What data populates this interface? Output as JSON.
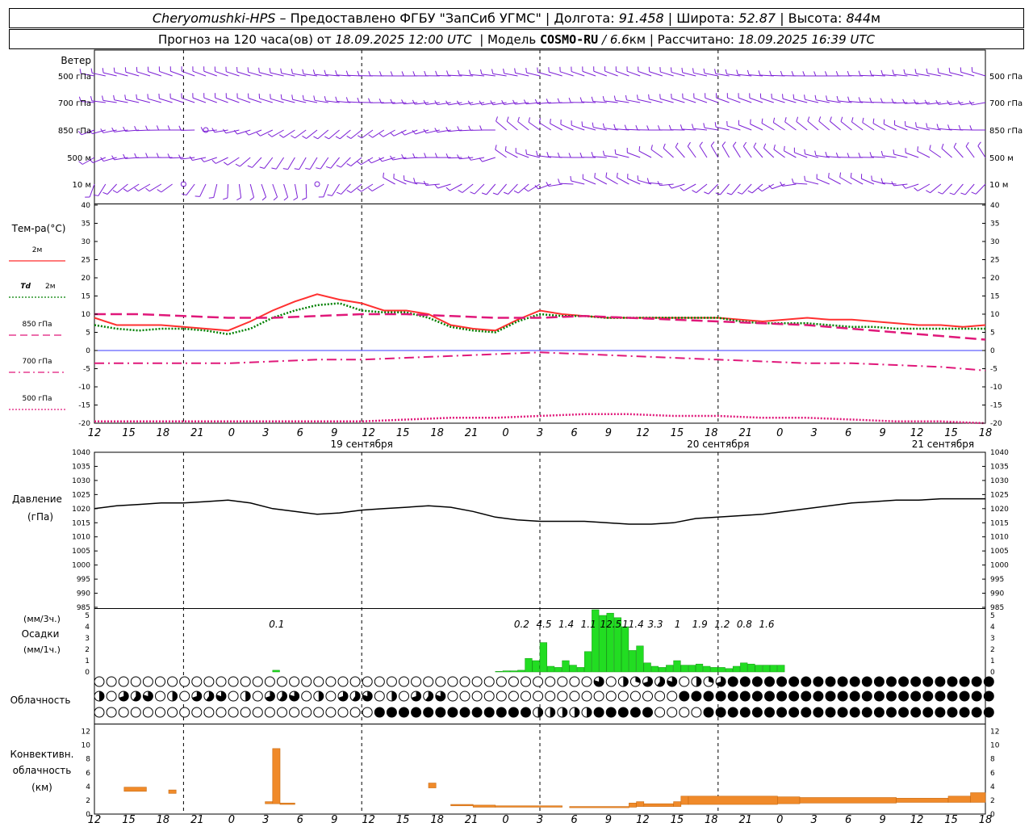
{
  "header": {
    "station": "Cheryomushki-HPS",
    "provided_label": "Предоставлено ФГБУ \"ЗапСиб УГМС\"",
    "lon_label": "Долгота:",
    "lon_value": "91.458",
    "lat_label": "Широта:",
    "lat_value": "52.87",
    "alt_label": "Высота:",
    "alt_value": "844",
    "alt_unit": "м",
    "forecast_prefix": "Прогноз на 120 часа(ов) от",
    "forecast_date": "18.09.2025 12:00 UTC",
    "model_label": "Модель",
    "model_name": "COSMO-RU",
    "model_res": "/ 6.6",
    "model_res_unit": "км",
    "computed_label": "Рассчитано:",
    "computed_date": "18.09.2025 16:39 UTC"
  },
  "time_axis": {
    "hour_ticks": [
      "12",
      "15",
      "18",
      "21",
      "0",
      "3",
      "6",
      "9",
      "12",
      "15",
      "18",
      "21",
      "0",
      "3",
      "6",
      "9",
      "12",
      "15",
      "18",
      "21",
      "0",
      "3",
      "6",
      "9",
      "12",
      "15",
      "18"
    ],
    "day_labels": [
      "19 сентября",
      "20 сентября",
      "21 сентября"
    ]
  },
  "wind_panel": {
    "title": "Ветер",
    "levels": [
      "500 гПа",
      "700 гПа",
      "850 гПа",
      "500 м",
      "10 м"
    ],
    "colors": {
      "barbs": "#7b1fd6"
    }
  },
  "temp_panel": {
    "title": "Тем-ра(°C)",
    "legend": [
      {
        "label": "2м",
        "color": "#ff2a2a",
        "style": "solid"
      },
      {
        "label_pre": "Td",
        "label": "2м",
        "color": "#008000",
        "style": "dotted"
      },
      {
        "label": "850 гПа",
        "color": "#e0187a",
        "style": "dashed"
      },
      {
        "label": "700 гПа",
        "color": "#e0187a",
        "style": "dashdot"
      },
      {
        "label": "500 гПа",
        "color": "#e0187a",
        "style": "dotted"
      }
    ],
    "y_ticks": [
      "40",
      "35",
      "30",
      "25",
      "20",
      "15",
      "10",
      "5",
      "0",
      "-5",
      "-10",
      "-15",
      "-20"
    ]
  },
  "pressure_panel": {
    "title": "Давление",
    "unit": "(гПа)",
    "y_ticks": [
      "1040",
      "1035",
      "1030",
      "1025",
      "1020",
      "1015",
      "1010",
      "1005",
      "1000",
      "995",
      "990",
      "985"
    ]
  },
  "precip_panel": {
    "unit_3h": "(мм/3ч.)",
    "title": "Осадки",
    "unit_1h": "(мм/1ч.)",
    "y_ticks": [
      "5",
      "4",
      "3",
      "2",
      "1",
      "0"
    ],
    "totals_3h": [
      {
        "hour": 24.0,
        "text": "0.1"
      },
      {
        "hour": 57.0,
        "text": "0.2"
      },
      {
        "hour": 60.0,
        "text": "4.5"
      },
      {
        "hour": 63.0,
        "text": "1.4"
      },
      {
        "hour": 66.0,
        "text": "1.1"
      },
      {
        "hour": 69.0,
        "text": "12.5"
      },
      {
        "hour": 72.0,
        "text": "11.4"
      },
      {
        "hour": 75.0,
        "text": "3.3"
      },
      {
        "hour": 78.0,
        "text": "1"
      },
      {
        "hour": 81.0,
        "text": "1.9"
      },
      {
        "hour": 84.0,
        "text": "1.2"
      },
      {
        "hour": 87.0,
        "text": "0.8"
      },
      {
        "hour": 90.0,
        "text": "1.6"
      }
    ]
  },
  "cloud_panel": {
    "title": "Облачность"
  },
  "conv_panel": {
    "title_1": "Конвективн.",
    "title_2": "облачность",
    "unit": "(км)",
    "y_ticks": [
      "12",
      "10",
      "8",
      "6",
      "4",
      "2",
      "0"
    ]
  },
  "chart_data": [
    {
      "type": "line",
      "title": "Тем-ра(°C)",
      "ylim": [
        -20,
        40
      ],
      "x_unit": "hours from 18.09.2025 12:00 UTC",
      "series": [
        {
          "name": "2м",
          "x": [
            0,
            3,
            6,
            9,
            12,
            15,
            18,
            21,
            24,
            27,
            30,
            33,
            36,
            39,
            42,
            45,
            48,
            51,
            54,
            57,
            60,
            63,
            66,
            69,
            72,
            75,
            78,
            81,
            84,
            87,
            90,
            93,
            96,
            99,
            102,
            105,
            108,
            111,
            114,
            117,
            120
          ],
          "values": [
            9,
            7,
            7,
            7,
            6.5,
            6,
            5.5,
            8,
            11,
            13.5,
            15.5,
            14,
            13,
            11,
            11,
            10,
            7,
            6,
            5.5,
            8.5,
            11,
            10,
            9.5,
            9,
            9,
            9,
            9,
            9,
            9,
            8.5,
            8,
            8.5,
            9,
            8.5,
            8.5,
            8,
            7.5,
            7,
            7,
            6.5,
            7
          ]
        },
        {
          "name": "Td 2м",
          "x": [
            0,
            3,
            6,
            9,
            12,
            15,
            18,
            21,
            24,
            27,
            30,
            33,
            36,
            39,
            42,
            45,
            48,
            51,
            54,
            57,
            60,
            63,
            66,
            69,
            72,
            75,
            78,
            81,
            84,
            87,
            90,
            93,
            96,
            99,
            102,
            105,
            108,
            111,
            114,
            117,
            120
          ],
          "values": [
            7,
            6,
            5.5,
            6,
            6,
            5.5,
            4.5,
            6,
            9,
            11,
            12.5,
            13,
            11,
            10.5,
            10.5,
            9,
            6.5,
            5.5,
            5,
            8,
            10,
            9.5,
            9.5,
            9,
            9,
            9,
            9,
            9,
            9,
            8,
            7.5,
            7.5,
            7.5,
            7,
            6.5,
            6.5,
            6,
            6,
            6,
            6,
            6
          ]
        },
        {
          "name": "850 гПа",
          "x": [
            0,
            6,
            12,
            18,
            24,
            30,
            36,
            42,
            48,
            54,
            60,
            66,
            72,
            78,
            84,
            90,
            96,
            102,
            108,
            114,
            120
          ],
          "values": [
            10,
            10,
            9.5,
            9,
            9,
            9.5,
            10,
            10,
            9.5,
            9,
            9,
            9.5,
            9,
            8.5,
            8,
            7.5,
            7,
            6,
            5,
            4,
            3
          ]
        },
        {
          "name": "700 гПа",
          "x": [
            0,
            6,
            12,
            18,
            24,
            30,
            36,
            42,
            48,
            54,
            60,
            66,
            72,
            78,
            84,
            90,
            96,
            102,
            108,
            114,
            120
          ],
          "values": [
            -3.5,
            -3.5,
            -3.5,
            -3.5,
            -3,
            -2.5,
            -2.5,
            -2,
            -1.5,
            -1,
            -0.5,
            -1,
            -1.5,
            -2,
            -2.5,
            -3,
            -3.5,
            -3.5,
            -4,
            -4.5,
            -5.5
          ]
        },
        {
          "name": "500 гПа",
          "x": [
            0,
            6,
            12,
            18,
            24,
            30,
            36,
            42,
            48,
            54,
            60,
            66,
            72,
            78,
            84,
            90,
            96,
            102,
            108,
            114,
            120
          ],
          "values": [
            -19.5,
            -19.5,
            -19.5,
            -19.5,
            -19.5,
            -19.5,
            -19.5,
            -19,
            -18.5,
            -18.5,
            -18,
            -17.5,
            -17.5,
            -18,
            -18,
            -18.5,
            -18.5,
            -19,
            -19.5,
            -19.5,
            -20
          ]
        }
      ]
    },
    {
      "type": "line",
      "title": "Давление",
      "ylim": [
        985,
        1040
      ],
      "x_unit": "hours from 18.09.2025 12:00 UTC",
      "series": [
        {
          "name": "Давление",
          "x": [
            0,
            3,
            6,
            9,
            12,
            15,
            18,
            21,
            24,
            27,
            30,
            33,
            36,
            39,
            42,
            45,
            48,
            51,
            54,
            57,
            60,
            63,
            66,
            69,
            72,
            75,
            78,
            81,
            84,
            87,
            90,
            93,
            96,
            99,
            102,
            105,
            108,
            111,
            114,
            117,
            120
          ],
          "values": [
            1020,
            1021,
            1021.5,
            1022,
            1022,
            1022.5,
            1023,
            1022,
            1020,
            1019,
            1018,
            1018.5,
            1019.5,
            1020,
            1020.5,
            1021,
            1020.5,
            1019,
            1017,
            1016,
            1015.5,
            1015.5,
            1015.5,
            1015,
            1014.5,
            1014.5,
            1015,
            1016.5,
            1017,
            1017.5,
            1018,
            1019,
            1020,
            1021,
            1022,
            1022.5,
            1023,
            1023,
            1023.5,
            1023.5,
            1023.5
          ]
        }
      ]
    },
    {
      "type": "bar",
      "title": "Осадки",
      "ylim": [
        0,
        5
      ],
      "x_unit": "hours from 18.09.2025 12:00 UTC",
      "x": [
        24,
        54,
        55,
        56,
        57,
        58,
        59,
        60,
        61,
        62,
        63,
        64,
        65,
        66,
        67,
        68,
        69,
        70,
        71,
        72,
        73,
        74,
        75,
        76,
        77,
        78,
        79,
        80,
        81,
        82,
        83,
        84,
        85,
        86,
        87,
        88,
        89,
        90,
        91,
        92
      ],
      "values": [
        0.15,
        0.05,
        0.1,
        0.1,
        0.15,
        1.2,
        1.0,
        2.6,
        0.5,
        0.4,
        1.0,
        0.6,
        0.4,
        1.8,
        5.5,
        5.0,
        5.2,
        4.8,
        4.0,
        1.9,
        2.3,
        0.8,
        0.5,
        0.4,
        0.6,
        1.0,
        0.6,
        0.6,
        0.7,
        0.5,
        0.4,
        0.4,
        0.3,
        0.5,
        0.8,
        0.7,
        0.6,
        0.6,
        0.6,
        0.6
      ]
    },
    {
      "type": "bar",
      "title": "Конвективн. облачность",
      "ylim": [
        0,
        13
      ],
      "x_unit": "hours from 18.09.2025 12:00 UTC",
      "bars": [
        {
          "x0": 4,
          "x1": 7,
          "low": 3.3,
          "high": 3.9
        },
        {
          "x0": 10,
          "x1": 11,
          "low": 3.0,
          "high": 3.5
        },
        {
          "x0": 23,
          "x1": 24,
          "low": 1.5,
          "high": 1.8
        },
        {
          "x0": 24,
          "x1": 25,
          "low": 1.5,
          "high": 9.5
        },
        {
          "x0": 25,
          "x1": 27,
          "low": 1.4,
          "high": 1.6
        },
        {
          "x0": 45,
          "x1": 46,
          "low": 3.8,
          "high": 4.5
        },
        {
          "x0": 48,
          "x1": 51,
          "low": 1.2,
          "high": 1.4
        },
        {
          "x0": 51,
          "x1": 54,
          "low": 1.0,
          "high": 1.3
        },
        {
          "x0": 54,
          "x1": 63,
          "low": 1.0,
          "high": 1.2
        },
        {
          "x0": 64,
          "x1": 72,
          "low": 1.0,
          "high": 1.1
        },
        {
          "x0": 72,
          "x1": 73,
          "low": 1.0,
          "high": 1.6
        },
        {
          "x0": 73,
          "x1": 74,
          "low": 1.1,
          "high": 1.8
        },
        {
          "x0": 74,
          "x1": 78,
          "low": 1.1,
          "high": 1.5
        },
        {
          "x0": 78,
          "x1": 79,
          "low": 1.1,
          "high": 1.8
        },
        {
          "x0": 79,
          "x1": 80,
          "low": 1.4,
          "high": 2.6
        },
        {
          "x0": 80,
          "x1": 92,
          "low": 1.4,
          "high": 2.6
        },
        {
          "x0": 92,
          "x1": 95,
          "low": 1.5,
          "high": 2.5
        },
        {
          "x0": 95,
          "x1": 108,
          "low": 1.6,
          "high": 2.4
        },
        {
          "x0": 108,
          "x1": 115,
          "low": 1.7,
          "high": 2.3
        },
        {
          "x0": 115,
          "x1": 118,
          "low": 1.7,
          "high": 2.6
        },
        {
          "x0": 118,
          "x1": 120,
          "low": 1.7,
          "high": 3.1
        }
      ]
    }
  ]
}
